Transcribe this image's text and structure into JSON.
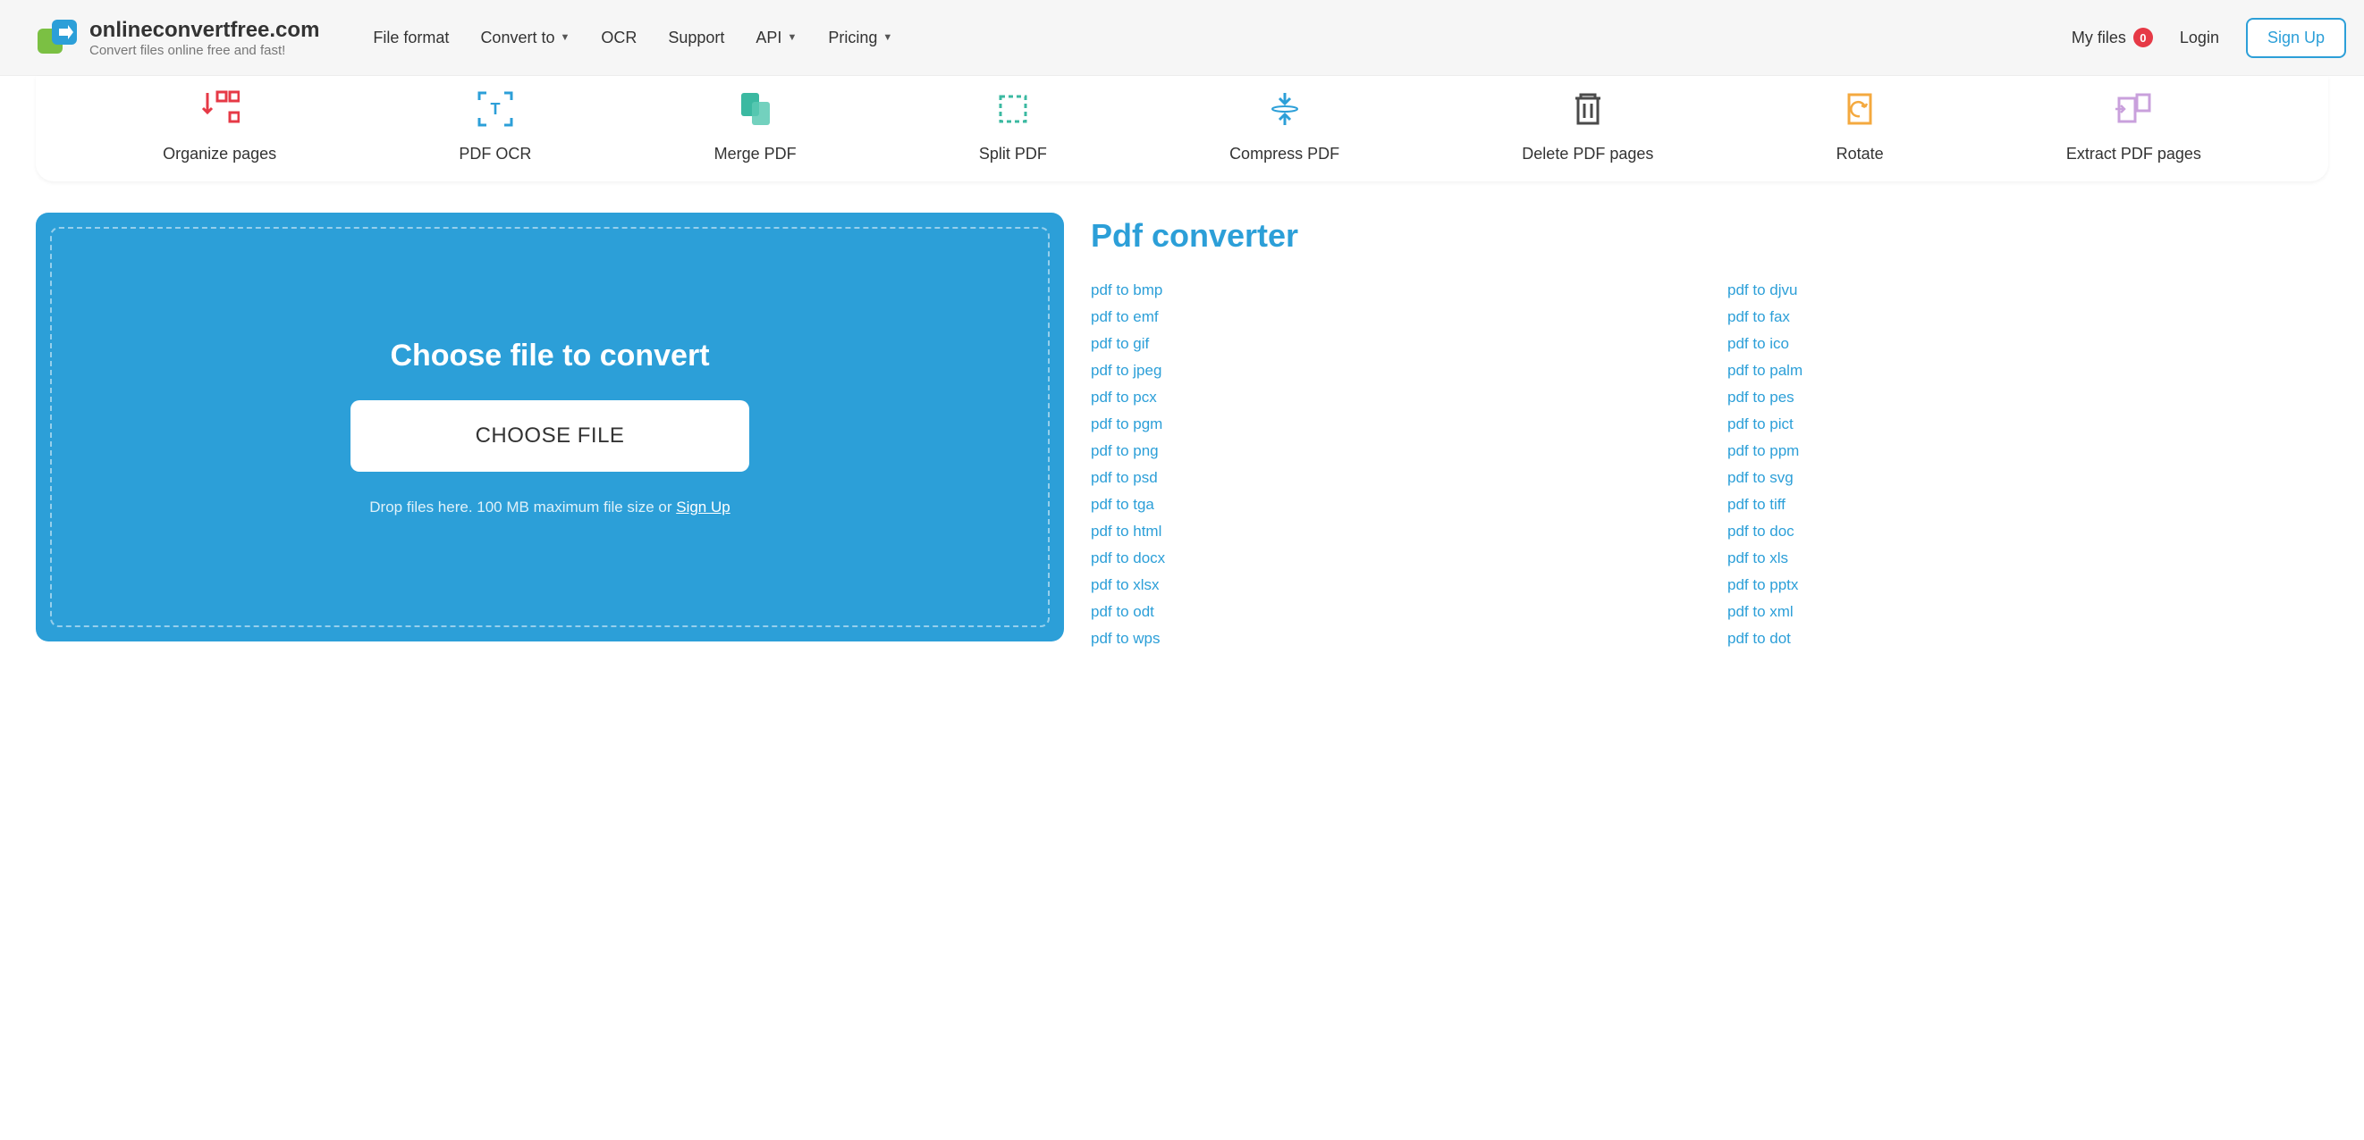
{
  "header": {
    "logo_title": "onlineconvertfree.com",
    "logo_sub": "Convert files online free and fast!",
    "nav": {
      "file_format": "File format",
      "convert_to": "Convert to",
      "ocr": "OCR",
      "support": "Support",
      "api": "API",
      "pricing": "Pricing"
    },
    "myfiles": "My files",
    "myfiles_count": "0",
    "login": "Login",
    "signup": "Sign Up"
  },
  "tools": {
    "organize": "Organize pages",
    "ocr": "PDF OCR",
    "merge": "Merge PDF",
    "split": "Split PDF",
    "compress": "Compress PDF",
    "delete": "Delete PDF pages",
    "rotate": "Rotate",
    "extract": "Extract PDF pages"
  },
  "dropzone": {
    "title": "Choose file to convert",
    "button": "CHOOSE FILE",
    "hint_prefix": "Drop files here. 100 MB maximum file size or ",
    "hint_link": "Sign Up"
  },
  "sidebar": {
    "title": "Pdf converter",
    "left": [
      "pdf to bmp",
      "pdf to emf",
      "pdf to gif",
      "pdf to jpeg",
      "pdf to pcx",
      "pdf to pgm",
      "pdf to png",
      "pdf to psd",
      "pdf to tga",
      "pdf to html",
      "pdf to docx",
      "pdf to xlsx",
      "pdf to odt",
      "pdf to wps"
    ],
    "right": [
      "pdf to djvu",
      "pdf to fax",
      "pdf to ico",
      "pdf to palm",
      "pdf to pes",
      "pdf to pict",
      "pdf to ppm",
      "pdf to svg",
      "pdf to tiff",
      "pdf to doc",
      "pdf to xls",
      "pdf to pptx",
      "pdf to xml",
      "pdf to dot"
    ]
  }
}
